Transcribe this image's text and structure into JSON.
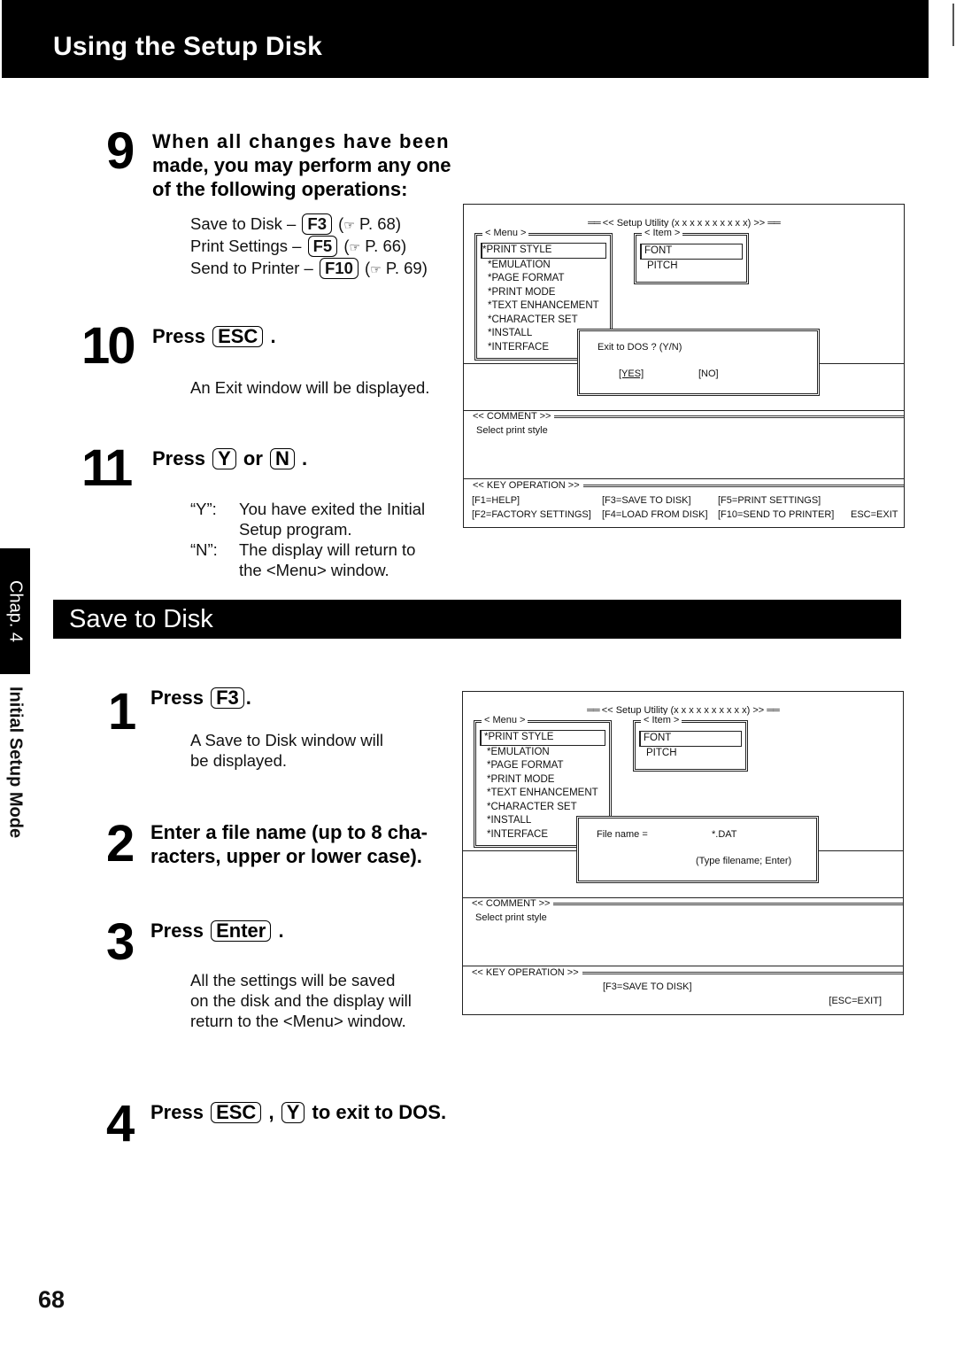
{
  "header": {
    "title": "Using the Setup Disk"
  },
  "side_tab": {
    "chapter": "Chap. 4",
    "mode": "Initial Setup Mode"
  },
  "section": {
    "title": "Save to Disk"
  },
  "page_number": "68",
  "steps_top": [
    {
      "number": "9",
      "heading": [
        "When all changes have been",
        "made, you may perform any one",
        "of the following operations:"
      ],
      "operations": [
        {
          "label": "Save to Disk –",
          "key": "F3",
          "ref": "P. 68"
        },
        {
          "label": "Print Settings –",
          "key": "F5",
          "ref": "P. 66"
        },
        {
          "label": "Send to Printer –",
          "key": "F10",
          "ref": "P. 69"
        }
      ]
    },
    {
      "number": "10",
      "prefix": "Press",
      "key": "ESC",
      "suffix": ".",
      "description": "An Exit window will be displayed."
    },
    {
      "number": "11",
      "prefix": "Press",
      "key1": "Y",
      "middle": "or",
      "key2": "N",
      "suffix": ".",
      "notes": [
        {
          "tag": "“Y”:",
          "lines": [
            "You have exited the Initial",
            "Setup program."
          ]
        },
        {
          "tag": "“N”:",
          "lines": [
            "The display will return to",
            "the <Menu> window."
          ]
        }
      ]
    }
  ],
  "steps_bottom": [
    {
      "number": "1",
      "prefix": "Press",
      "key": "F3",
      "suffix": ".",
      "description": [
        "A Save to Disk window will",
        "be displayed."
      ]
    },
    {
      "number": "2",
      "heading": [
        "Enter a file name (up to 8 cha-",
        "racters, upper or lower case)."
      ]
    },
    {
      "number": "3",
      "prefix": "Press",
      "key": "Enter",
      "suffix": ".",
      "description": [
        "All the settings will be saved",
        "on the disk and the display will",
        "return to the <Menu> window."
      ]
    },
    {
      "number": "4",
      "prefix": "Press",
      "key1": "ESC",
      "comma": ",",
      "key2": "Y",
      "suffix": "to exit to DOS."
    }
  ],
  "reference_icon": "pointing-hand-icon",
  "screen1": {
    "title": "<< Setup Utility (x x x x x x   x x x x) >>",
    "menu_label": "< Menu >",
    "menu_items": [
      "*PRINT STYLE",
      "*EMULATION",
      "*PAGE FORMAT",
      "*PRINT MODE",
      "*TEXT ENHANCEMENT",
      "*CHARACTER SET",
      "*INSTALL",
      "*INTERFACE"
    ],
    "item_label": "< Item >",
    "item_items": [
      "FONT",
      "PITCH"
    ],
    "dialog": {
      "prompt": "Exit to DOS ? (Y/N)",
      "yes": "[YES]",
      "no": "[NO]"
    },
    "comment_label": "<< COMMENT >>",
    "comment_text": "Select print style",
    "keyop_label": "<< KEY OPERATION >>",
    "keyop_rows": [
      [
        "[F1=HELP]",
        "[F3=SAVE TO DISK]",
        "[F5=PRINT SETTINGS]",
        ""
      ],
      [
        "[F2=FACTORY SETTINGS]",
        "[F4=LOAD FROM DISK]",
        "[F10=SEND TO PRINTER]",
        "ESC=EXIT"
      ]
    ]
  },
  "screen2": {
    "title": "<< Setup Utility (x x x x x x   x x x x) >>",
    "menu_label": "< Menu >",
    "menu_items": [
      "*PRINT STYLE",
      "*EMULATION",
      "*PAGE FORMAT",
      "*PRINT MODE",
      "*TEXT ENHANCEMENT",
      "*CHARACTER SET",
      "*INSTALL",
      "*INTERFACE"
    ],
    "item_label": "< Item >",
    "item_items": [
      "FONT",
      "PITCH"
    ],
    "dialog": {
      "field_label": "File name =",
      "field_value": "*.DAT",
      "hint": "(Type filename; Enter)"
    },
    "comment_label": "<< COMMENT >>",
    "comment_text": "Select print style",
    "keyop_label": "<< KEY OPERATION >>",
    "keyop_main": "[F3=SAVE TO DISK]",
    "keyop_exit": "[ESC=EXIT]"
  }
}
